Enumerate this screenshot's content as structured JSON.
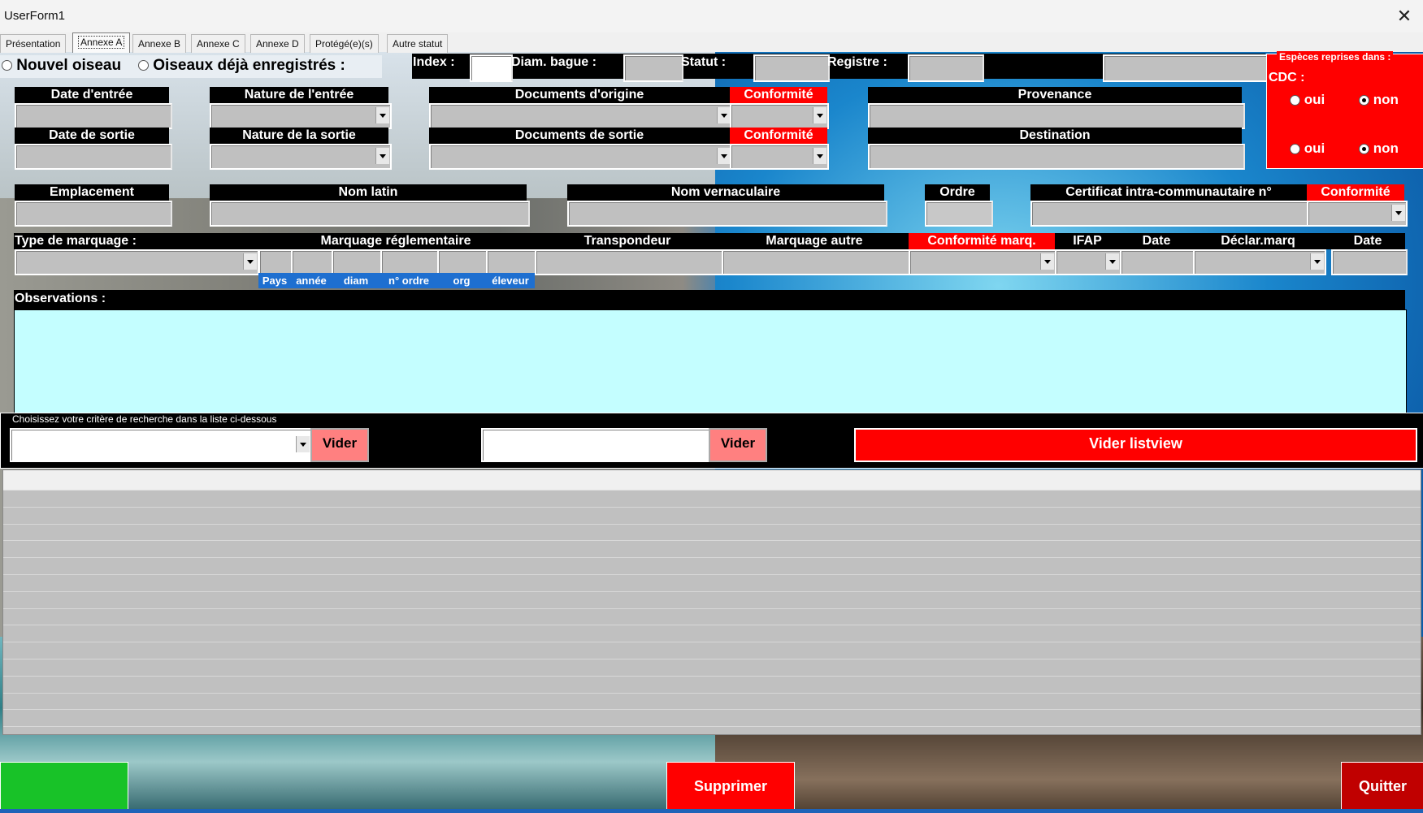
{
  "window": {
    "title": "UserForm1",
    "close_glyph": "✕"
  },
  "tabs": [
    "Présentation",
    "Annexe A",
    "Annexe B",
    "Annexe C",
    "Annexe D",
    "Protégé(e)(s)",
    "Autre statut"
  ],
  "active_tab": "Annexe A",
  "top_row": {
    "nouvel_oiseau": "Nouvel oiseau",
    "oiseaux_enregistres": "Oiseaux déjà enregistrés :",
    "index_label": "Index :",
    "diam_label": "Diam. bague  :",
    "statut_label": "Statut :",
    "registre_label": "Registre :"
  },
  "cdc": {
    "legend": "Espèces reprises dans :",
    "label": "CDC :",
    "oui": "oui",
    "non": "non"
  },
  "row1": {
    "date_entree": "Date d'entrée",
    "nature_entree": "Nature de l'entrée",
    "documents_origine": "Documents d'origine",
    "conformite": "Conformité",
    "provenance": "Provenance"
  },
  "row2": {
    "date_sortie": "Date de sortie",
    "nature_sortie": "Nature de la sortie",
    "documents_sortie": "Documents de sortie",
    "conformite": "Conformité",
    "destination": "Destination"
  },
  "row3": {
    "emplacement": "Emplacement",
    "nom_latin": "Nom latin",
    "nom_vernaculaire": "Nom vernaculaire",
    "ordre": "Ordre",
    "certificat": "Certificat intra-communautaire n°",
    "conformite": "Conformité"
  },
  "row4": {
    "type_marquage": "Type de marquage :",
    "marquage_reglementaire": "Marquage réglementaire",
    "transpondeur": "Transpondeur",
    "marquage_autre": "Marquage autre",
    "conformite_marq": "Conformité marq.",
    "ifap": "IFAP",
    "date": "Date",
    "declar_marq": "Déclar.marq",
    "date2": "Date",
    "sub_labels": [
      "Pays",
      "année",
      "diam",
      "n° ordre",
      "org",
      "éleveur"
    ]
  },
  "observations": {
    "label": "Observations  :"
  },
  "search": {
    "legend": "Choisissez votre critère de recherche dans la liste ci-dessous",
    "vider": "Vider",
    "vider_listview": "Vider listview"
  },
  "listview": {
    "rows": 14
  },
  "bottom": {
    "supprimer": "Supprimer",
    "quitter": "Quitter"
  },
  "colors": {
    "red": "#ff0000",
    "black": "#000000",
    "field_gray": "#c0c0c0",
    "obs_cyan": "#c4feff",
    "green": "#18c228",
    "pink": "#ff8080"
  }
}
